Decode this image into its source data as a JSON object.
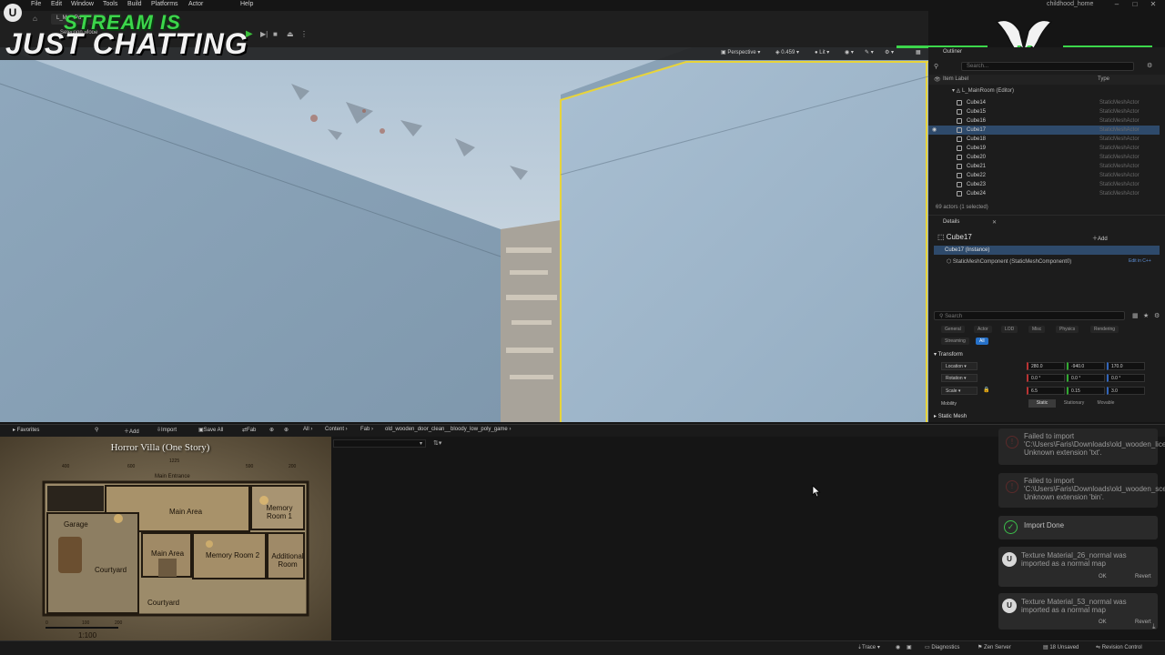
{
  "app": {
    "window_title": "childhood_home",
    "logo_glyph": "U",
    "menu": [
      "File",
      "Edit",
      "Window",
      "Tools",
      "Build",
      "Platforms",
      "Actor",
      "Help"
    ]
  },
  "toolbar": {
    "level_tab": "L_MainRoom",
    "selection_mode": "Selection Mode",
    "overlay_line1": "STREAM IS",
    "overlay_line2": "JUST CHATTING",
    "badge_letter": "K"
  },
  "viewport": {
    "perspective_label": "Perspective",
    "fov_value": "0.459",
    "lit_label": "Lit"
  },
  "outliner": {
    "tab_label": "Outliner",
    "search_placeholder": "Search...",
    "col_label": "Item Label",
    "col_type": "Type",
    "root": "L_MainRoom (Editor)",
    "rows": [
      {
        "label": "Cube14",
        "type": "StaticMeshActor",
        "selected": false
      },
      {
        "label": "Cube15",
        "type": "StaticMeshActor",
        "selected": false
      },
      {
        "label": "Cube16",
        "type": "StaticMeshActor",
        "selected": false
      },
      {
        "label": "Cube17",
        "type": "StaticMeshActor",
        "selected": true
      },
      {
        "label": "Cube18",
        "type": "StaticMeshActor",
        "selected": false
      },
      {
        "label": "Cube19",
        "type": "StaticMeshActor",
        "selected": false
      },
      {
        "label": "Cube20",
        "type": "StaticMeshActor",
        "selected": false
      },
      {
        "label": "Cube21",
        "type": "StaticMeshActor",
        "selected": false
      },
      {
        "label": "Cube22",
        "type": "StaticMeshActor",
        "selected": false
      },
      {
        "label": "Cube23",
        "type": "StaticMeshActor",
        "selected": false
      },
      {
        "label": "Cube24",
        "type": "StaticMeshActor",
        "selected": false
      }
    ],
    "footer": "69 actors (1 selected)"
  },
  "details": {
    "tab_label": "Details",
    "actor_name": "Cube17",
    "add_label": "Add",
    "instance_label": "Cube17 (Instance)",
    "component_label": "StaticMeshComponent (StaticMeshComponent0)",
    "edit_cpp": "Edit in C++",
    "search_placeholder": "Search",
    "filter_tabs": [
      "General",
      "Actor",
      "LOD",
      "Misc",
      "Physics",
      "Rendering",
      "Streaming",
      "All"
    ],
    "active_tab": "All",
    "section_transform": "Transform",
    "location": {
      "label": "Location",
      "x": "280.0",
      "y": "-940.0",
      "z": "170.0"
    },
    "rotation": {
      "label": "Rotation",
      "x": "0.0 °",
      "y": "0.0 °",
      "z": "0.0 °"
    },
    "scale": {
      "label": "Scale",
      "x": "6.5",
      "y": "0.15",
      "z": "3.0"
    },
    "mobility": {
      "label": "Mobility",
      "options": [
        "Static",
        "Stationary",
        "Movable"
      ],
      "selected": "Static"
    },
    "section_mesh": "Static Mesh"
  },
  "content_browser": {
    "favorites": "Favorites",
    "add": "Add",
    "import": "Import",
    "save_all": "Save All",
    "fab": "Fab",
    "breadcrumb": [
      "All",
      "Content",
      "Fab",
      "old_wooden_door_clean__bloody_low_poly_game"
    ]
  },
  "floorplan": {
    "title": "Horror Villa (One Story)",
    "rooms": [
      "Main Entrance",
      "Garage",
      "Main Area",
      "Memory Room 1",
      "Main Area",
      "Memory Room 2",
      "Additional Room",
      "Courtyard",
      "Courtyard"
    ],
    "ruler_top": [
      "400",
      "600",
      "1225",
      "590",
      "200"
    ],
    "ruler_bottom": [
      "0",
      "100",
      "200"
    ],
    "scale": "1:100"
  },
  "notifications": [
    {
      "text": "Failed to import 'C:\\Users\\Faris\\Downloads\\old_wooden_license.txt'. Unknown extension 'txt'.",
      "kind": "error"
    },
    {
      "text": "Failed to import 'C:\\Users\\Faris\\Downloads\\old_wooden_scene.bin'. Unknown extension 'bin'.",
      "kind": "error"
    },
    {
      "text": "Import Done",
      "kind": "success"
    },
    {
      "text": "Texture Material_26_normal was imported as a normal map",
      "kind": "info",
      "ok": "OK",
      "revert": "Revert"
    },
    {
      "text": "Texture Material_53_normal was imported as a normal map",
      "kind": "info",
      "ok": "OK",
      "revert": "Revert"
    }
  ],
  "statusbar": {
    "trace": "Trace",
    "diagnostics": "Diagnostics",
    "zen": "Zen Server",
    "unsaved": "18 Unsaved",
    "revision": "Revision Control"
  },
  "colors": {
    "accent": "#2671c9",
    "selection_outline": "#e8d43a",
    "overlay_green": "#3cd64b"
  }
}
